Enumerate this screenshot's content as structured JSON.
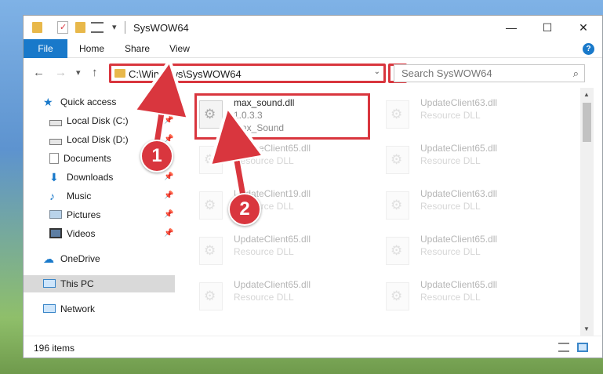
{
  "window": {
    "title": "SysWOW64",
    "qat_dropdown": "▾",
    "minimize": "—",
    "maximize": "☐",
    "close": "✕"
  },
  "ribbon": {
    "tabs": [
      "File",
      "Home",
      "Share",
      "View"
    ],
    "help": "?"
  },
  "navbar": {
    "back": "←",
    "forward": "→",
    "recent": "▾",
    "up": "↑",
    "address": "C:\\Windows\\SysWOW64",
    "address_dropdown": "⌄",
    "refresh": "↻",
    "search_placeholder": "Search SysWOW64",
    "search_icon": "⌕"
  },
  "nav_pane": {
    "items": [
      {
        "label": "Quick access",
        "icon": "star-icon",
        "pinned": false
      },
      {
        "label": "Local Disk (C:)",
        "icon": "drive-icon",
        "pinned": true
      },
      {
        "label": "Local Disk (D:)",
        "icon": "drive-icon",
        "pinned": true
      },
      {
        "label": "Documents",
        "icon": "documents-icon",
        "pinned": true
      },
      {
        "label": "Downloads",
        "icon": "download-icon",
        "pinned": true
      },
      {
        "label": "Music",
        "icon": "music-icon",
        "pinned": true
      },
      {
        "label": "Pictures",
        "icon": "pictures-icon",
        "pinned": true
      },
      {
        "label": "Videos",
        "icon": "videos-icon",
        "pinned": true
      },
      {
        "label": "OneDrive",
        "icon": "cloud-icon",
        "pinned": false
      },
      {
        "label": "This PC",
        "icon": "pc-icon",
        "pinned": false,
        "selected": true
      },
      {
        "label": "Network",
        "icon": "network-icon",
        "pinned": false
      }
    ],
    "pin_glyph": "📌"
  },
  "files": [
    {
      "name": "max_sound.dll",
      "line2": "1.0.3.3",
      "line3": "Max_Sound",
      "highlighted": true
    },
    {
      "name": "UpdateClient63.dll",
      "line2": "Resource DLL",
      "faded": true
    },
    {
      "name": "UpdateClient65.dll",
      "line2": "Resource DLL",
      "faded": true
    },
    {
      "name": "UpdateClient65.dll",
      "line2": "Resource DLL",
      "faded": true
    },
    {
      "name": "UpdateClient19.dll",
      "line2": "Resource DLL",
      "faded": true
    },
    {
      "name": "UpdateClient63.dll",
      "line2": "Resource DLL",
      "faded": true
    },
    {
      "name": "UpdateClient65.dll",
      "line2": "Resource DLL",
      "faded": true
    },
    {
      "name": "UpdateClient65.dll",
      "line2": "Resource DLL",
      "faded": true
    },
    {
      "name": "UpdateClient65.dll",
      "line2": "Resource DLL",
      "faded": true
    },
    {
      "name": "UpdateClient65.dll",
      "line2": "Resource DLL",
      "faded": true
    }
  ],
  "annotations": {
    "step1": "1",
    "step2": "2"
  },
  "status": {
    "item_count": "196 items"
  },
  "colors": {
    "accent": "#1979ca",
    "annotation_red": "#d9363e",
    "folder_yellow": "#e8b84a"
  }
}
